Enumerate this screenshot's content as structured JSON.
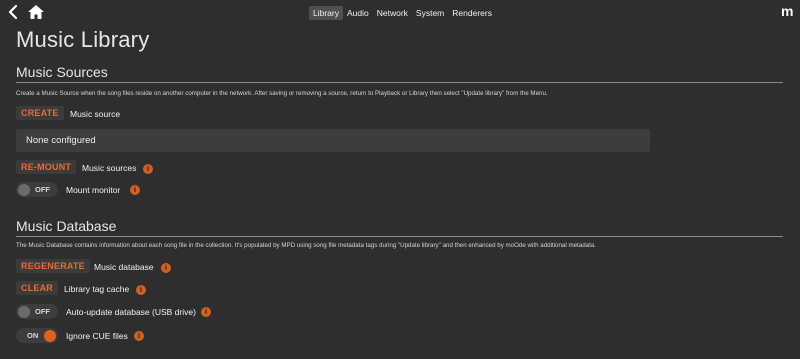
{
  "header": {
    "tabs": [
      {
        "label": "Library",
        "active": true
      },
      {
        "label": "Audio",
        "active": false
      },
      {
        "label": "Network",
        "active": false
      },
      {
        "label": "System",
        "active": false
      },
      {
        "label": "Renderers",
        "active": false
      }
    ],
    "brand": "m"
  },
  "page_title": "Music Library",
  "sources": {
    "title": "Music Sources",
    "description": "Create a Music Source when the song files reside on another computer in the network. After saving or removing a source, return to Playback or Library then select \"Update library\" from the Menu.",
    "create_label": "CREATE",
    "create_text": "Music source",
    "none_configured": "None configured",
    "remount_label": "RE-MOUNT",
    "remount_text": "Music sources",
    "mount_monitor_state": "OFF",
    "mount_monitor_text": "Mount monitor"
  },
  "database": {
    "title": "Music Database",
    "description": "The Music Database contains information about each song file in the collection. It's populated by MPD using song file metadata tags during \"Update library\" and then enhanced by moOde with additional metadata.",
    "regenerate_label": "REGENERATE",
    "regenerate_text": "Music database",
    "clear_label": "CLEAR",
    "clear_text": "Library tag cache",
    "auto_update_state": "OFF",
    "auto_update_text": "Auto-update database (USB drive)",
    "ignore_cue_state": "ON",
    "ignore_cue_text": "Ignore CUE files"
  },
  "info_icon_glyph": "i",
  "colors": {
    "accent": "#e0611f",
    "background": "#2e2e2e"
  }
}
